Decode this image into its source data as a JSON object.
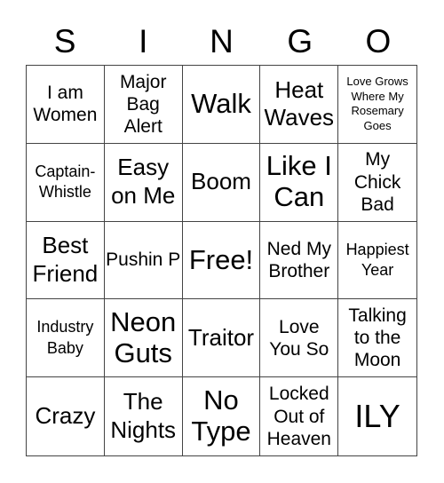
{
  "header": {
    "letters": [
      "S",
      "I",
      "N",
      "G",
      "O"
    ]
  },
  "cells": [
    {
      "text": "I am Women",
      "size": "s-md"
    },
    {
      "text": "Major Bag Alert",
      "size": "s-md"
    },
    {
      "text": "Walk",
      "size": "s-xl"
    },
    {
      "text": "Heat Waves",
      "size": "s-lg"
    },
    {
      "text": "Love Grows Where My Rosemary Goes",
      "size": "s-xs"
    },
    {
      "text": "Captain-Whistle",
      "size": "s-sm"
    },
    {
      "text": "Easy on Me",
      "size": "s-lg"
    },
    {
      "text": "Boom",
      "size": "s-lg"
    },
    {
      "text": "Like I Can",
      "size": "s-xl"
    },
    {
      "text": "My Chick Bad",
      "size": "s-md"
    },
    {
      "text": "Best Friend",
      "size": "s-lg"
    },
    {
      "text": "Pushin P",
      "size": "s-md"
    },
    {
      "text": "Free!",
      "size": "s-xl"
    },
    {
      "text": "Ned My Brother",
      "size": "s-md"
    },
    {
      "text": "Happiest Year",
      "size": "s-sm"
    },
    {
      "text": "Industry Baby",
      "size": "s-sm"
    },
    {
      "text": "Neon Guts",
      "size": "s-xl"
    },
    {
      "text": "Traitor",
      "size": "s-lg"
    },
    {
      "text": "Love You So",
      "size": "s-md"
    },
    {
      "text": "Talking to the Moon",
      "size": "s-md"
    },
    {
      "text": "Crazy",
      "size": "s-lg"
    },
    {
      "text": "The Nights",
      "size": "s-lg"
    },
    {
      "text": "No Type",
      "size": "s-xl"
    },
    {
      "text": "Locked Out of Heaven",
      "size": "s-md"
    },
    {
      "text": "ILY",
      "size": "s-xxl"
    }
  ]
}
